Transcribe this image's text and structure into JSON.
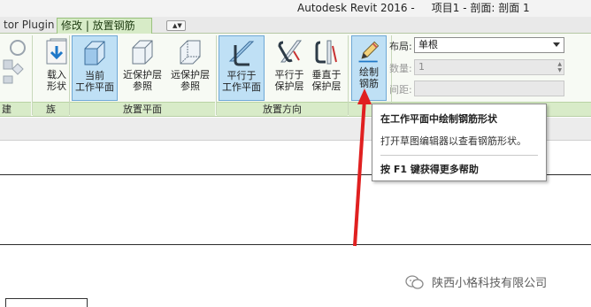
{
  "window": {
    "app_title": "Autodesk Revit 2016 -     项目1 - 剖面: 剖面 1"
  },
  "tabs": {
    "plugin_label": "tor Plugin",
    "active_label": "修改 | 放置钢筋",
    "minimize_glyph": "▲▼"
  },
  "ribbon": {
    "buttons": {
      "load_shape": "载入\n形状",
      "current_workplane": "当前\n工作平面",
      "near_cover": "近保护层\n参照",
      "far_cover": "远保护层\n参照",
      "parallel_workplane": "平行于\n工作平面",
      "parallel_cover": "平行于\n保护层",
      "perpendicular_cover": "垂直于\n保护层",
      "draw": "绘制\n钢筋"
    },
    "panels": {
      "left_stub": "建",
      "family": "族",
      "placement_plane": "放置平面",
      "placement_direction": "放置方向"
    },
    "options": {
      "layout_label": "布局:",
      "layout_value": "单根",
      "quantity_label": "数量:",
      "quantity_value": "1",
      "spacing_label": "间距:"
    }
  },
  "tooltip": {
    "title": "在工作平面中绘制钢筋形状",
    "description": "打开草图编辑器以查看钢筋形状。",
    "help": "按 F1 键获得更多帮助"
  },
  "watermark": {
    "text": "陕西小格科技有限公司"
  },
  "colors": {
    "arrow": "#e02020",
    "ribbon_bg": "#f7faf4",
    "panel_bar": "#d8ebc8",
    "selected": "#bfe0f5"
  }
}
